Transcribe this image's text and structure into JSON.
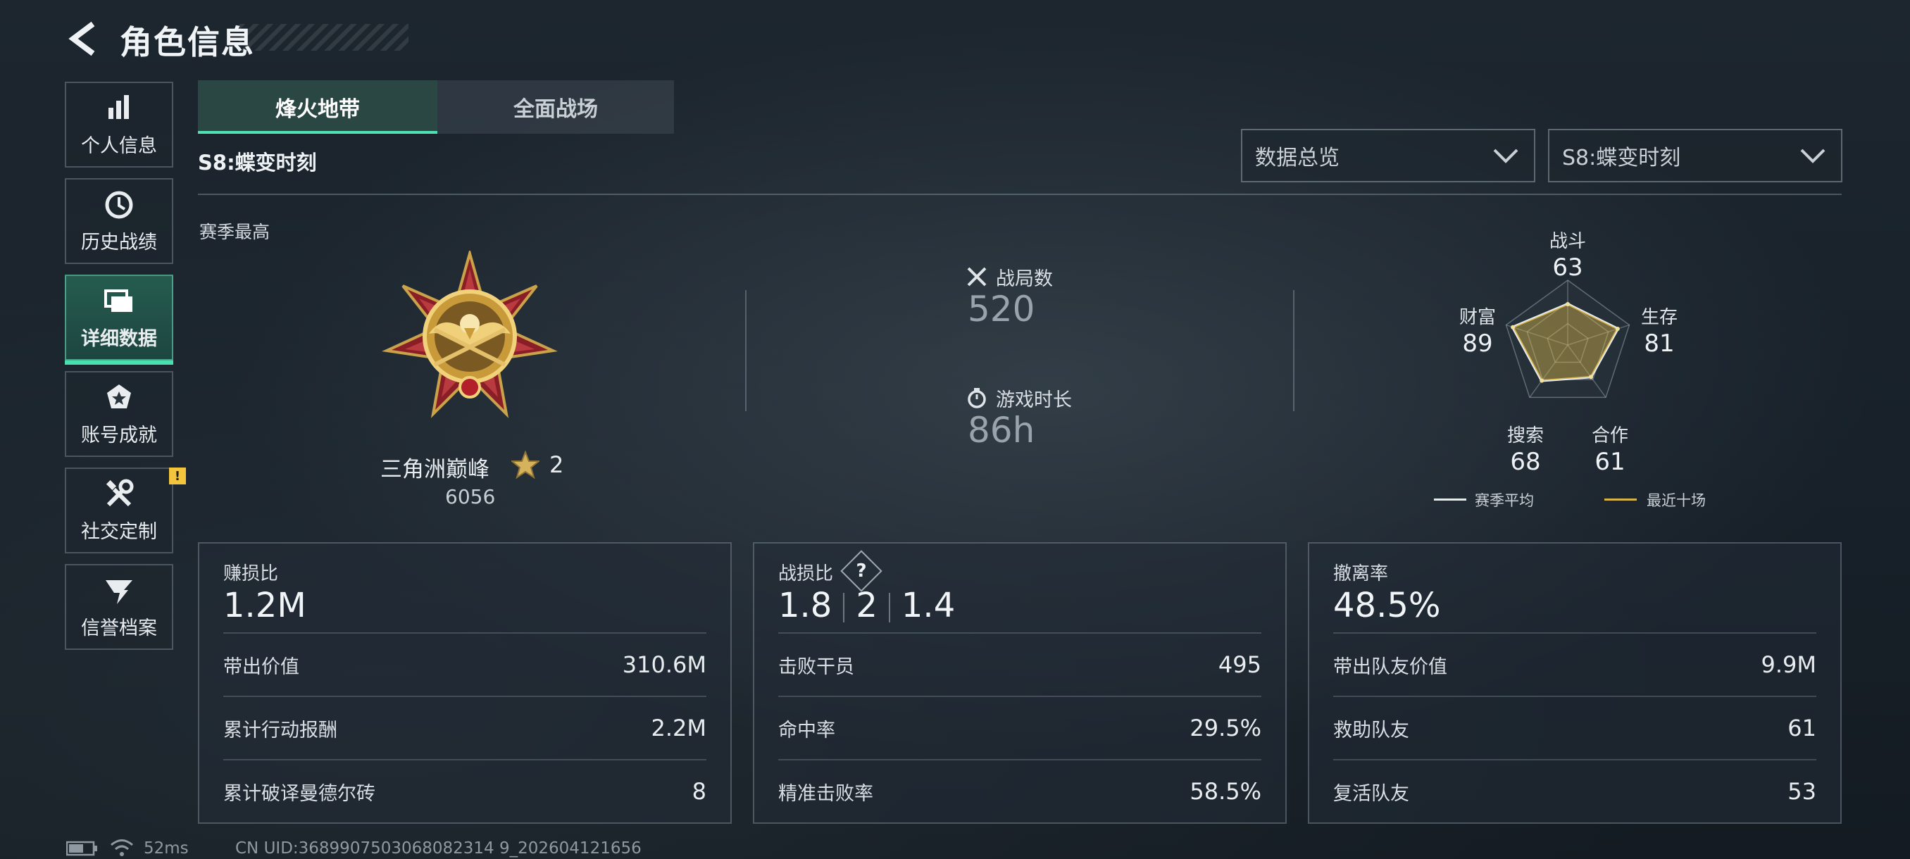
{
  "header": {
    "title": "角色信息"
  },
  "sidebar": {
    "items": [
      {
        "label": "个人信息",
        "icon": "bar-chart-icon"
      },
      {
        "label": "历史战绩",
        "icon": "history-icon"
      },
      {
        "label": "详细数据",
        "icon": "detail-data-icon"
      },
      {
        "label": "账号成就",
        "icon": "achievement-icon"
      },
      {
        "label": "社交定制",
        "icon": "tools-icon",
        "badge": "!"
      },
      {
        "label": "信誉档案",
        "icon": "credit-icon"
      }
    ]
  },
  "tabs": [
    {
      "label": "烽火地带"
    },
    {
      "label": "全面战场"
    }
  ],
  "season_name": "S8:蝶变时刻",
  "dropdowns": {
    "overview": "数据总览",
    "season": "S8:蝶变时刻"
  },
  "season_best_label": "赛季最高",
  "rank": {
    "name": "三角洲巅峰",
    "stars": "2",
    "points": "6056"
  },
  "stats": {
    "matches_label": "战局数",
    "matches_value": "520",
    "playtime_label": "游戏时长",
    "playtime_value": "86h"
  },
  "radar": {
    "axes": [
      {
        "label": "战斗",
        "value": "63"
      },
      {
        "label": "生存",
        "value": "81"
      },
      {
        "label": "合作",
        "value": "61"
      },
      {
        "label": "搜索",
        "value": "68"
      },
      {
        "label": "财富",
        "value": "89"
      }
    ],
    "legend_avg": "赛季平均",
    "legend_recent": "最近十场",
    "color_avg": "#e6ebee",
    "color_recent": "#d6b44a"
  },
  "cards": {
    "profit": {
      "title": "赚损比",
      "main": "1.2M",
      "rows": [
        {
          "label": "带出价值",
          "value": "310.6M"
        },
        {
          "label": "累计行动报酬",
          "value": "2.2M"
        },
        {
          "label": "累计破译曼德尔砖",
          "value": "8"
        }
      ]
    },
    "kd": {
      "title": "战损比",
      "v1": "1.8",
      "v2": "2",
      "v3": "1.4",
      "help": "?",
      "rows": [
        {
          "label": "击败干员",
          "value": "495"
        },
        {
          "label": "命中率",
          "value": "29.5%"
        },
        {
          "label": "精准击败率",
          "value": "58.5%"
        }
      ]
    },
    "extract": {
      "title": "撤离率",
      "main": "48.5%",
      "rows": [
        {
          "label": "带出队友价值",
          "value": "9.9M"
        },
        {
          "label": "救助队友",
          "value": "61"
        },
        {
          "label": "复活队友",
          "value": "53"
        }
      ]
    }
  },
  "footer": {
    "ping": "52ms",
    "uid": "CN UID:3689907503068082314 9_202604121656"
  }
}
